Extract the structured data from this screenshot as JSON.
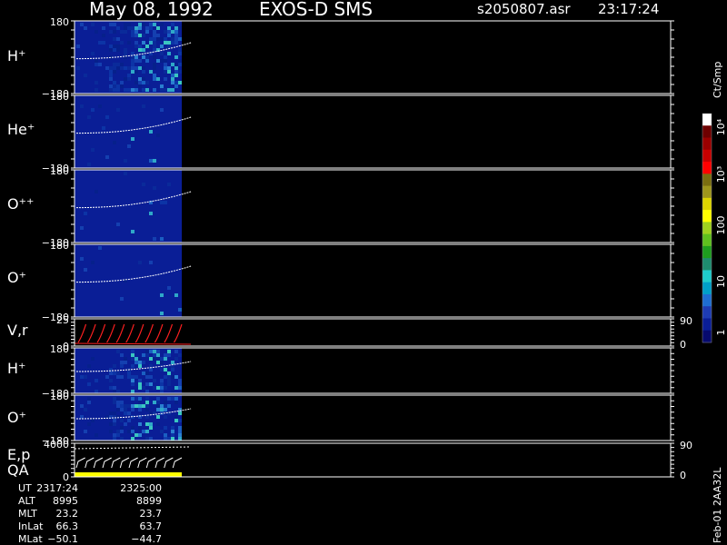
{
  "header": {
    "date": "May 08, 1992",
    "instrument": "EXOS-D SMS",
    "filename": "s2050807.asr",
    "time": "23:17:24"
  },
  "colorbar": {
    "unit_label": "Ct/Smp",
    "tick_labels": [
      "10⁴",
      "10³",
      "100",
      "10",
      "1"
    ],
    "colors": [
      "#ffffff",
      "#6e0000",
      "#9b0000",
      "#c80000",
      "#ff0000",
      "#7a6e10",
      "#9e961c",
      "#ddd400",
      "#ffff00",
      "#9fd21e",
      "#5fc01e",
      "#1e9e1e",
      "#1e8c6e",
      "#1ecccc",
      "#00a0c8",
      "#1e6ed2",
      "#1e3cb4",
      "#0a1e96",
      "#060a6e"
    ]
  },
  "chart_data": [
    {
      "type": "heatmap",
      "panel": "H+",
      "ylabel": "H⁺",
      "ytick_labels": [
        "180",
        "−180"
      ],
      "ylim": [
        -180,
        180
      ],
      "filled_fraction": 0.18
    },
    {
      "type": "heatmap",
      "panel": "He+",
      "ylabel": "He⁺",
      "ytick_labels": [
        "180",
        "−180"
      ],
      "ylim": [
        -180,
        180
      ],
      "filled_fraction": 0.18
    },
    {
      "type": "heatmap",
      "panel": "O++",
      "ylabel": "O⁺⁺",
      "ytick_labels": [
        "180",
        "−180"
      ],
      "ylim": [
        -180,
        180
      ],
      "filled_fraction": 0.18
    },
    {
      "type": "heatmap",
      "panel": "O+",
      "ylabel": "O⁺",
      "ytick_labels": [
        "180",
        "−180"
      ],
      "ylim": [
        -180,
        180
      ],
      "filled_fraction": 0.18
    },
    {
      "type": "line",
      "panel": "V,r",
      "ylabel": "V,r",
      "ytick_labels": [
        "25",
        "0"
      ],
      "right_tick_labels": [
        "90",
        "0"
      ],
      "ylim": [
        0,
        25
      ]
    },
    {
      "type": "heatmap",
      "panel": "H+ (2)",
      "ylabel": "H⁺",
      "ytick_labels": [
        "180",
        "−180"
      ],
      "ylim": [
        -180,
        180
      ],
      "filled_fraction": 0.18
    },
    {
      "type": "heatmap",
      "panel": "O+ (2)",
      "ylabel": "O⁺",
      "ytick_labels": [
        "180",
        "−180"
      ],
      "ylim": [
        -180,
        180
      ],
      "filled_fraction": 0.18
    },
    {
      "type": "line",
      "panel": "E,p QA",
      "ylabel": "E,p",
      "ylabel2": "QA",
      "ytick_labels": [
        "4000",
        "0"
      ],
      "right_tick_labels": [
        "90",
        "0"
      ],
      "ylim": [
        0,
        4000
      ]
    }
  ],
  "footer": {
    "rows": [
      {
        "label": "UT",
        "v1": "2317:24",
        "v2": "2325:00"
      },
      {
        "label": "ALT",
        "v1": "8995",
        "v2": "8899"
      },
      {
        "label": "MLT",
        "v1": "23.2",
        "v2": "23.7"
      },
      {
        "label": "InLat",
        "v1": "66.3",
        "v2": "63.7"
      },
      {
        "label": "MLat",
        "v1": "−50.1",
        "v2": "−44.7"
      }
    ],
    "version": "Feb-01 2AA32L"
  }
}
